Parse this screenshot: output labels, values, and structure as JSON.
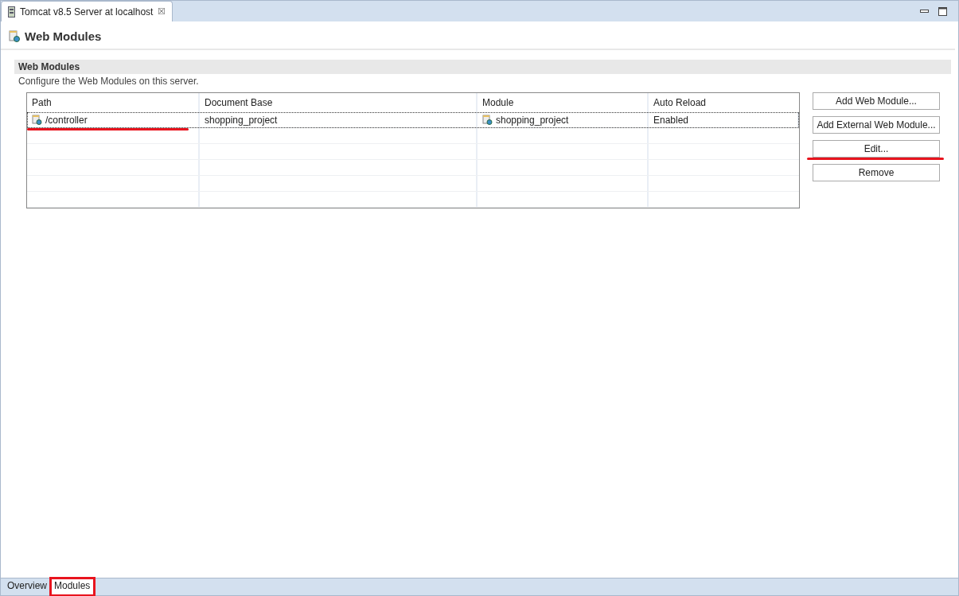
{
  "editor_tab": {
    "title": "Tomcat v8.5 Server at localhost",
    "close": "☒"
  },
  "page_title": "Web Modules",
  "section": {
    "title": "Web Modules",
    "description": "Configure the Web Modules on this server."
  },
  "table": {
    "columns": [
      "Path",
      "Document Base",
      "Module",
      "Auto Reload"
    ],
    "rows": [
      {
        "path": "/controller",
        "document_base": "shopping_project",
        "module": "shopping_project",
        "auto_reload": "Enabled",
        "selected": true,
        "underlined": true
      }
    ]
  },
  "buttons": [
    {
      "label": "Add Web Module...",
      "underlined": false
    },
    {
      "label": "Add External Web Module...",
      "underlined": false
    },
    {
      "label": "Edit...",
      "underlined": true
    },
    {
      "label": "Remove",
      "underlined": false
    }
  ],
  "bottom_tabs": [
    {
      "label": "Overview",
      "selected": false,
      "boxed": false
    },
    {
      "label": "Modules",
      "selected": true,
      "boxed": true
    }
  ]
}
